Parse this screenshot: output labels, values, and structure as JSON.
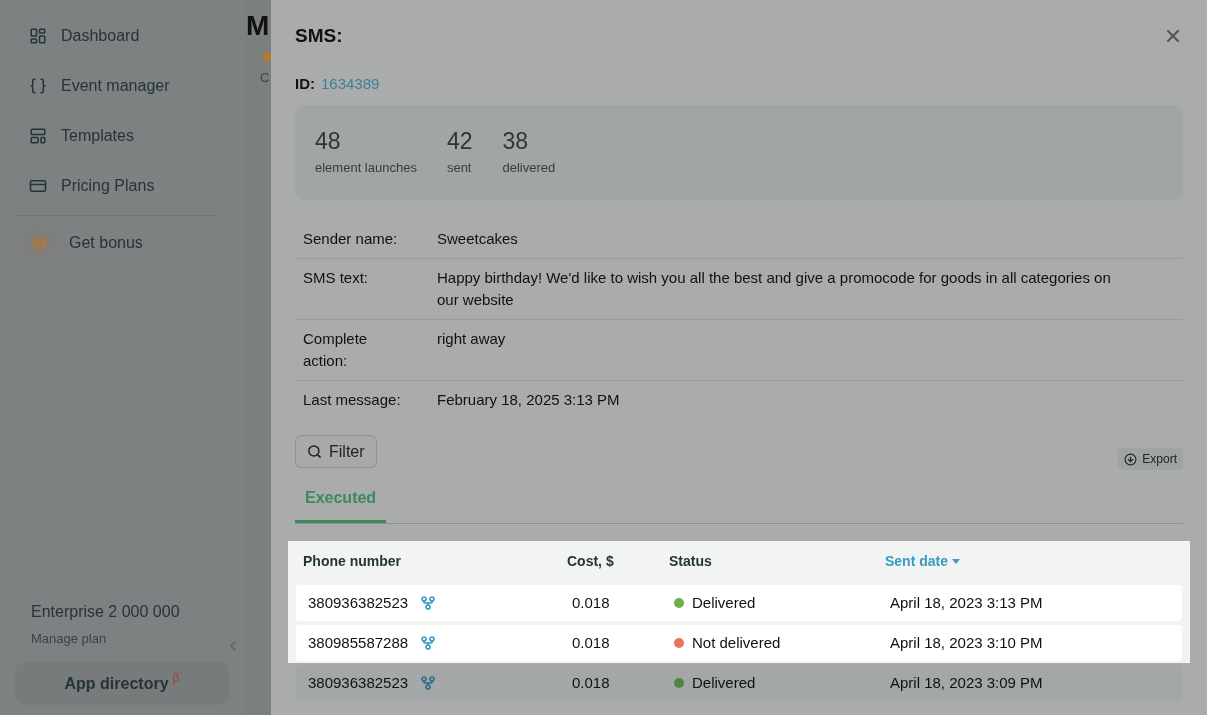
{
  "sidebar": {
    "items": [
      {
        "label": "Dashboard"
      },
      {
        "label": "Event manager"
      },
      {
        "label": "Templates"
      },
      {
        "label": "Pricing Plans"
      }
    ],
    "bonus": "Get bonus",
    "plan": {
      "name": "Enterprise 2 000 000",
      "link": "Manage plan"
    },
    "app_directory": {
      "label": "App directory",
      "badge": "β"
    }
  },
  "background_page": {
    "title": "M",
    "subtitle": "C"
  },
  "modal": {
    "title": "SMS:",
    "id_label": "ID:",
    "id": "1634389",
    "stats": [
      {
        "value": "48",
        "label": "element launches"
      },
      {
        "value": "42",
        "label": "sent"
      },
      {
        "value": "38",
        "label": "delivered"
      }
    ],
    "details": [
      {
        "label": "Sender name:",
        "value": "Sweetcakes"
      },
      {
        "label": "SMS text:",
        "value": "Happy birthday! We'd like to wish you all the best and give a promocode for goods in all categories on our website"
      },
      {
        "label": "Complete action:",
        "value": "right away"
      },
      {
        "label": "Last message:",
        "value": "February 18, 2025 3:13 PM"
      }
    ],
    "filter": "Filter",
    "export": "Export",
    "tabs": [
      {
        "label": "Executed",
        "selected": true
      }
    ],
    "table": {
      "columns": [
        {
          "label": "Phone number",
          "sorted": false
        },
        {
          "label": "Cost, $",
          "sorted": false
        },
        {
          "label": "Status",
          "sorted": false
        },
        {
          "label": "Sent date",
          "sorted": true
        }
      ],
      "rows": [
        {
          "phone": "380936382523",
          "cost": "0.018",
          "status": "Delivered",
          "color": "#6ab04c",
          "date": "April 18, 2023 3:13 PM",
          "highlighted": true
        },
        {
          "phone": "380985587288",
          "cost": "0.018",
          "status": "Not delivered",
          "color": "#e8735a",
          "date": "April 18, 2023 3:10 PM",
          "highlighted": true
        },
        {
          "phone": "380936382523",
          "cost": "0.018",
          "status": "Delivered",
          "color": "#4f8445",
          "date": "April 18, 2023 3:09 PM",
          "highlighted": false
        }
      ]
    }
  }
}
